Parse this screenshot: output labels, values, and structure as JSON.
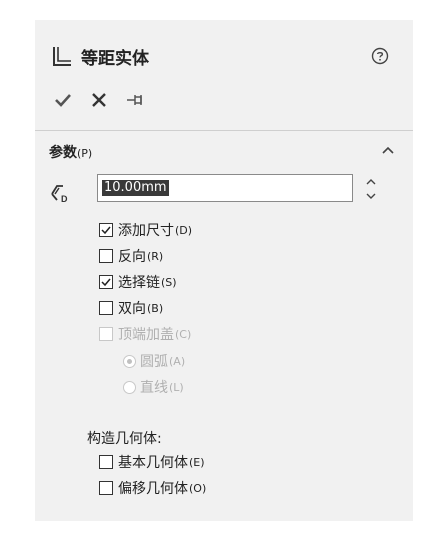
{
  "panel": {
    "title": "等距实体",
    "icons": {
      "feature": "offset-entities-icon",
      "help": "help-icon"
    }
  },
  "actions": {
    "ok": "checkmark-icon",
    "cancel": "close-icon",
    "pin": "pushpin-icon"
  },
  "parameters": {
    "title": "参数",
    "title_key": "(P)",
    "distance_value": "10.00mm",
    "options": [
      {
        "label": "添加尺寸",
        "key": "(D)",
        "checked": true,
        "enabled": true
      },
      {
        "label": "反向",
        "key": "(R)",
        "checked": false,
        "enabled": true
      },
      {
        "label": "选择链",
        "key": "(S)",
        "checked": true,
        "enabled": true
      },
      {
        "label": "双向",
        "key": "(B)",
        "checked": false,
        "enabled": true
      },
      {
        "label": "顶端加盖",
        "key": "(C)",
        "checked": false,
        "enabled": false
      }
    ],
    "cap_options": [
      {
        "label": "圆弧",
        "key": "(A)",
        "selected": true,
        "enabled": false
      },
      {
        "label": "直线",
        "key": "(L)",
        "selected": false,
        "enabled": false
      }
    ],
    "construct_label": "构造几何体:",
    "construct_options": [
      {
        "label": "基本几何体",
        "key": "(E)",
        "checked": false
      },
      {
        "label": "偏移几何体",
        "key": "(O)",
        "checked": false
      }
    ]
  },
  "colors": {
    "panel_bg": "#f1f1f1",
    "selection_bg": "#3a3a3a",
    "disabled_text": "#b0b0b0"
  }
}
